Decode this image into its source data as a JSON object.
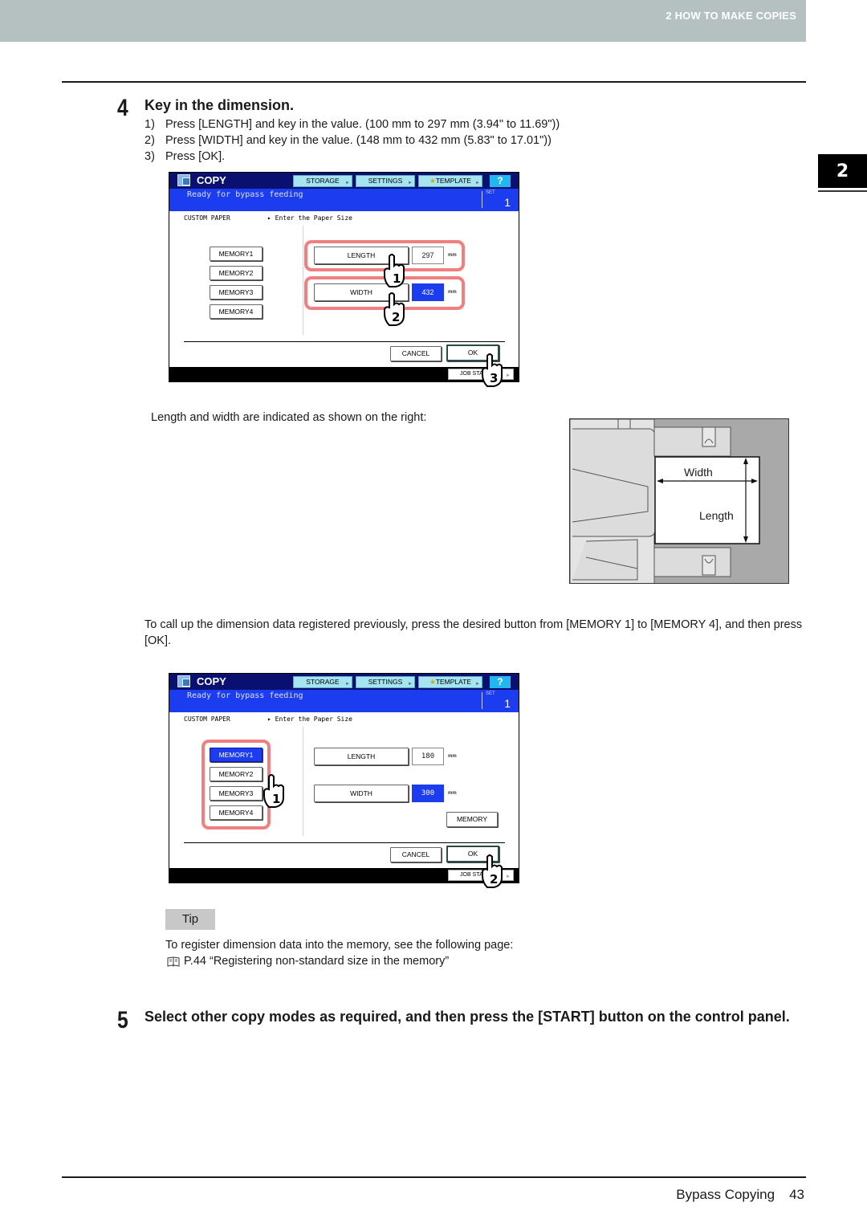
{
  "header": {
    "chapter_label": "2 HOW TO MAKE COPIES"
  },
  "chapter_tab": "2",
  "step4": {
    "number": "4",
    "title": "Key in the dimension.",
    "substeps": [
      {
        "num": "1)",
        "text": "Press [LENGTH] and key in the value. (100 mm to 297 mm (3.94\" to 11.69\"))"
      },
      {
        "num": "2)",
        "text": "Press [WIDTH] and key in the value. (148 mm to 432 mm (5.83\" to 17.01\"))"
      },
      {
        "num": "3)",
        "text": "Press [OK]."
      }
    ]
  },
  "screen1": {
    "app_title": "COPY",
    "tabs": [
      "STORAGE",
      "SETTINGS",
      "TEMPLATE"
    ],
    "help": "?",
    "status": "Ready for bypass feeding",
    "set_label": "SET",
    "set_value": "1",
    "crumb": "CUSTOM PAPER",
    "crumb_hint": "▸ Enter the Paper Size",
    "memory_buttons": [
      "MEMORY1",
      "MEMORY2",
      "MEMORY3",
      "MEMORY4"
    ],
    "length_label": "LENGTH",
    "length_value": "297",
    "width_label": "WIDTH",
    "width_value": "432",
    "unit": "mm",
    "cancel": "CANCEL",
    "ok": "OK",
    "job_status": "JOB STATUS",
    "callouts": [
      "1",
      "2",
      "3"
    ]
  },
  "illustration": {
    "width_label": "Width",
    "length_label": "Length"
  },
  "dimension_note": "Length and width are indicated as shown on the right:",
  "memory_note": "To call up the dimension data registered previously, press the desired button from [MEMORY 1] to [MEMORY 4], and then press [OK].",
  "screen2": {
    "app_title": "COPY",
    "tabs": [
      "STORAGE",
      "SETTINGS",
      "TEMPLATE"
    ],
    "help": "?",
    "status": "Ready for bypass feeding",
    "set_label": "SET",
    "set_value": "1",
    "crumb": "CUSTOM PAPER",
    "crumb_hint": "▸ Enter the Paper Size",
    "memory_buttons": [
      "MEMORY1",
      "MEMORY2",
      "MEMORY3",
      "MEMORY4"
    ],
    "selected_memory": "MEMORY1",
    "length_label": "LENGTH",
    "length_value": "180",
    "width_label": "WIDTH",
    "width_value": "300",
    "unit": "mm",
    "memory_button": "MEMORY",
    "cancel": "CANCEL",
    "ok": "OK",
    "job_status": "JOB STATUS",
    "callouts": [
      "1",
      "2"
    ]
  },
  "tip": {
    "label": "Tip",
    "text": "To register dimension data into the memory, see the following page:",
    "ref_icon": "book-icon",
    "ref_text": "P.44 “Registering non-standard size in the memory”"
  },
  "step5": {
    "number": "5",
    "title": "Select other copy modes as required, and then press the [START] button on the control panel."
  },
  "footer": {
    "section": "Bypass Copying",
    "page": "43"
  },
  "colors": {
    "header_band": "#b5c1c1",
    "screen_topbar": "#0a1070",
    "screen_status": "#1c3cf0",
    "tab_button": "#a6e4f2",
    "help_button": "#22b7f0",
    "highlight": "#f08080",
    "illustration_tray": "#a9a9a9"
  }
}
